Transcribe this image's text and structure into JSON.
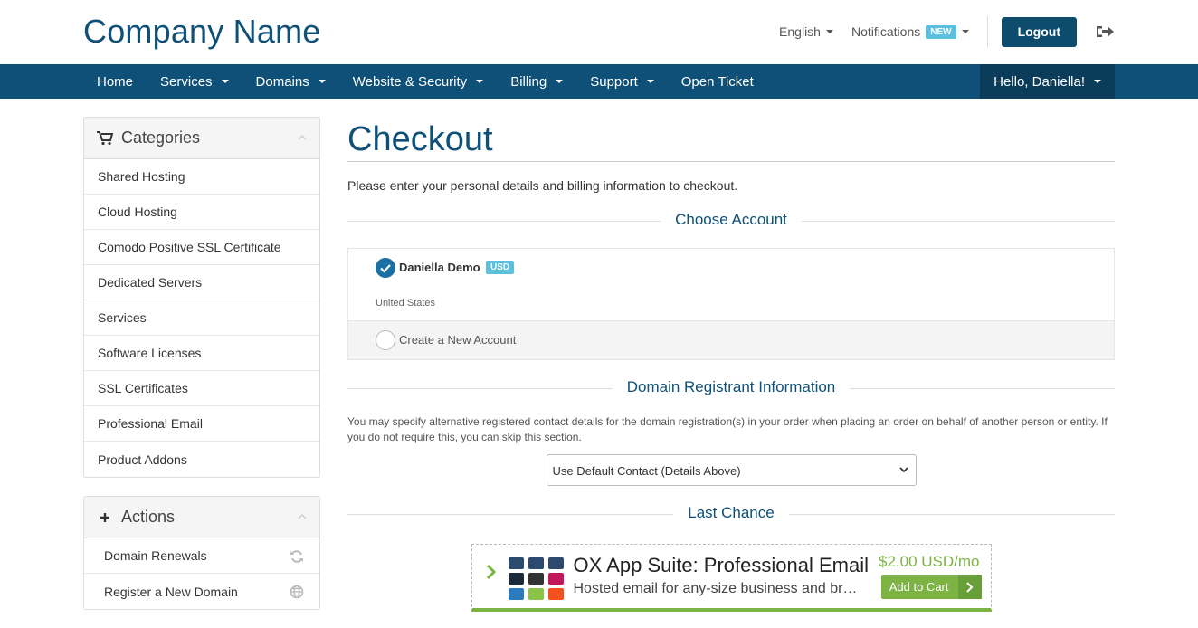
{
  "brand": {
    "name": "Company Name"
  },
  "topbar": {
    "language": "English",
    "notifications": "Notifications",
    "notifications_badge": "NEW",
    "logout": "Logout"
  },
  "nav": {
    "items": [
      {
        "label": "Home"
      },
      {
        "label": "Services"
      },
      {
        "label": "Domains"
      },
      {
        "label": "Website & Security"
      },
      {
        "label": "Billing"
      },
      {
        "label": "Support"
      },
      {
        "label": "Open Ticket"
      }
    ],
    "user": "Hello, Daniella!"
  },
  "sidebar": {
    "categories": {
      "title": "Categories",
      "items": [
        "Shared Hosting",
        "Cloud Hosting",
        "Comodo Positive SSL Certificate",
        "Dedicated Servers",
        "Services",
        "Software Licenses",
        "SSL Certificates",
        "Professional Email",
        "Product Addons"
      ]
    },
    "actions": {
      "title": "Actions",
      "items": [
        "Domain Renewals",
        "Register a New Domain"
      ]
    }
  },
  "main": {
    "title": "Checkout",
    "intro": "Please enter your personal details and billing information to checkout.",
    "choose_account": {
      "title": "Choose Account",
      "account_name": "Daniella Demo",
      "currency": "USD",
      "country": "United States",
      "new_account": "Create a New Account"
    },
    "registrant": {
      "title": "Domain Registrant Information",
      "help": "You may specify alternative registered contact details for the domain registration(s) in your order when placing an order on behalf of another person or entity. If you do not require this, you can skip this section.",
      "select_value": "Use Default Contact (Details Above)"
    },
    "last_chance": {
      "title": "Last Chance",
      "product": "OX App Suite: Professional Email",
      "description": "Hosted email for any-size business and brand",
      "price": "$2.00 USD/mo",
      "button": "Add to Cart"
    }
  },
  "colors": {
    "primary": "#0e5077",
    "nav_user_bg": "#0b3c59",
    "badge": "#5bc0de",
    "green": "#7cb342"
  }
}
